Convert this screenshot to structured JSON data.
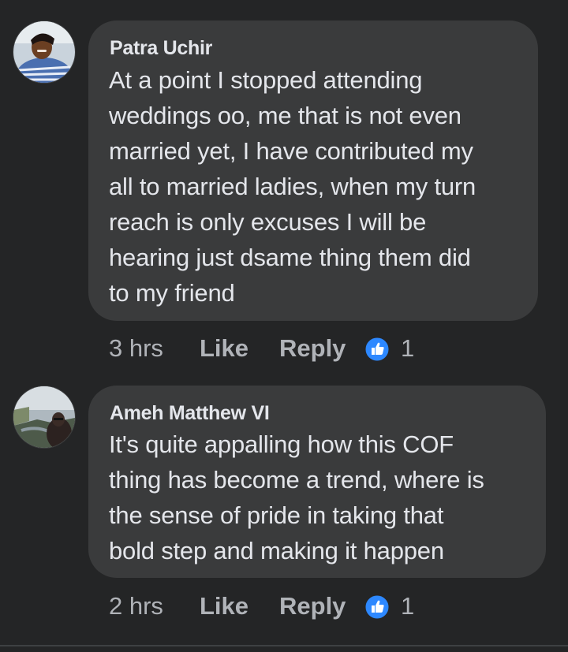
{
  "comments": [
    {
      "author": "Patra Uchir",
      "text": "At a point I stopped attending\nweddings oo, me that is not even\nmarried yet, I have contributed my\nall to married ladies, when my turn\nreach is only excuses I will be\nhearing just dsame thing them did\nto my friend",
      "time": "3 hrs",
      "like_label": "Like",
      "reply_label": "Reply",
      "reaction_icon": "like-reaction-icon",
      "reaction_count": "1"
    },
    {
      "author": "Ameh Matthew VI",
      "text": "It's quite appalling how this COF\nthing has become a trend, where is\nthe sense of pride in taking that\nbold step and making it happen",
      "time": "2 hrs",
      "like_label": "Like",
      "reply_label": "Reply",
      "reaction_icon": "like-reaction-icon",
      "reaction_count": "1"
    }
  ],
  "colors": {
    "background": "#242526",
    "bubble": "#3a3b3c",
    "text": "#e4e6eb",
    "secondary_text": "#b0b3b8",
    "like_blue": "#2d88ff"
  }
}
